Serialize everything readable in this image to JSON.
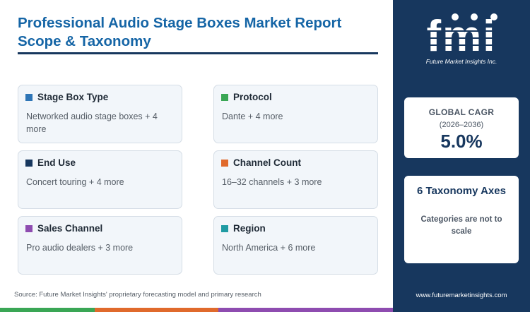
{
  "title": "Professional Audio Stage Boxes Market Report Scope & Taxonomy",
  "cards": [
    {
      "title": "Stage Box Type",
      "value": "Networked audio stage boxes + 4 more",
      "color": "#2e75b6"
    },
    {
      "title": "Protocol",
      "value": "Dante + 4 more",
      "color": "#3aa655"
    },
    {
      "title": "End Use",
      "value": "Concert touring + 4 more",
      "color": "#17375e"
    },
    {
      "title": "Channel Count",
      "value": "16–32 channels + 3 more",
      "color": "#e06a2c"
    },
    {
      "title": "Sales Channel",
      "value": "Pro audio dealers + 3 more",
      "color": "#8e4cb0"
    },
    {
      "title": "Region",
      "value": "North America + 6 more",
      "color": "#1f9ba3"
    }
  ],
  "source": "Source: Future Market Insights' proprietary forecasting model and primary research",
  "logo": {
    "mark": "fmi",
    "tagline": "Future Market Insights Inc."
  },
  "cagr": {
    "label": "GLOBAL CAGR",
    "years": "(2026–2036)",
    "value": "5.0%"
  },
  "taxonomy": {
    "title": "6 Taxonomy Axes",
    "note": "Categories are not to scale"
  },
  "website": "www.futuremarketinsights.com",
  "colors": {
    "navy": "#17375e",
    "title_blue": "#1565a6",
    "bar": [
      "#3aa655",
      "#e06a2c",
      "#8e4cb0",
      "#17375e"
    ]
  }
}
